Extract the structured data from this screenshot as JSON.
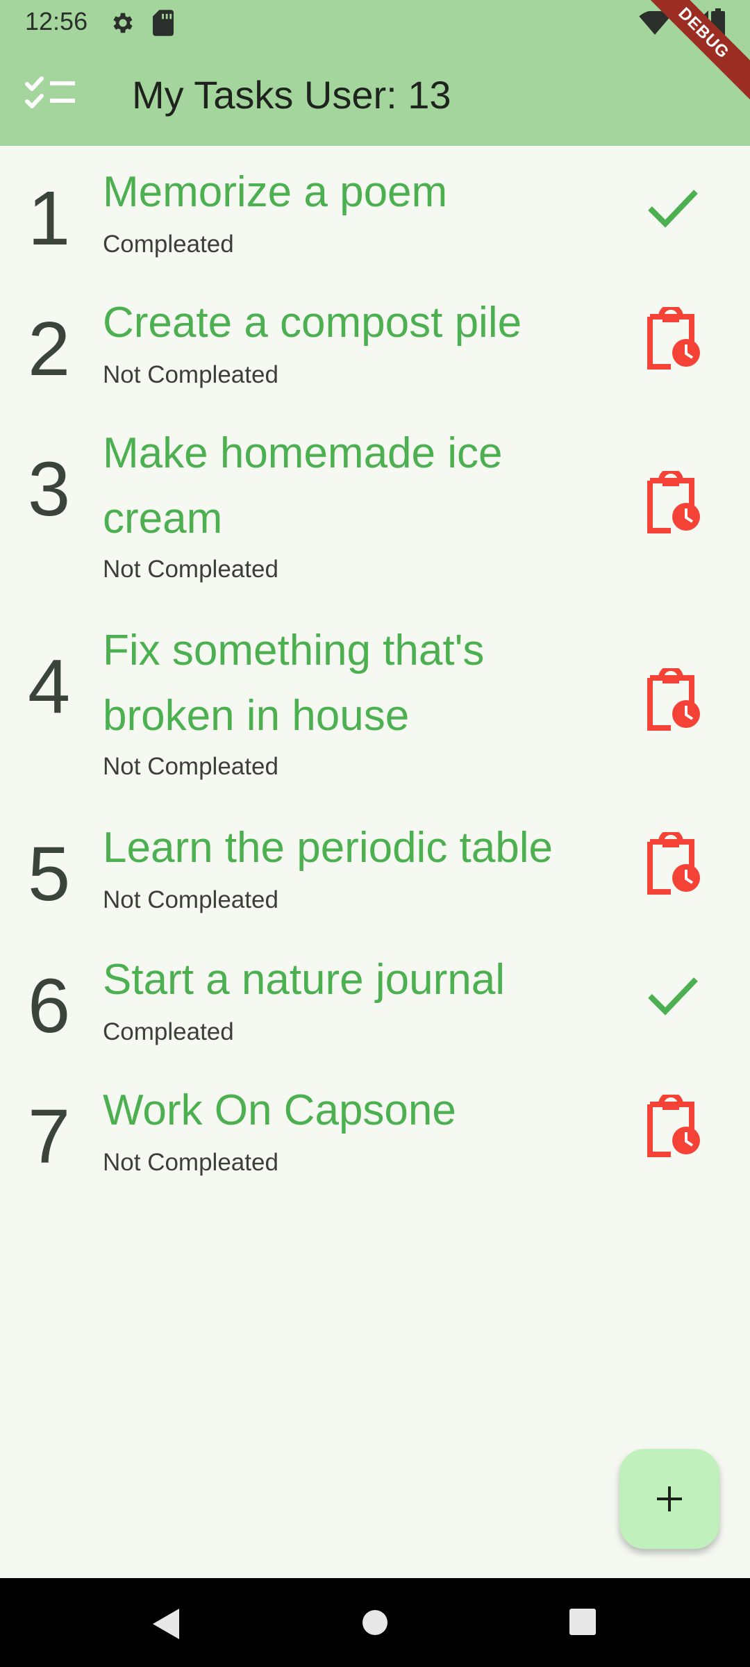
{
  "status_bar": {
    "time": "12:56"
  },
  "debug_banner": "DEBUG",
  "app_bar": {
    "title": "My Tasks User: 13",
    "icon": "checklist-icon"
  },
  "tasks": [
    {
      "number": "1",
      "title": "Memorize a poem",
      "status": "Compleated",
      "icon": "check-icon"
    },
    {
      "number": "2",
      "title": "Create a compost pile",
      "status": "Not Compleated",
      "icon": "pending-clipboard-icon"
    },
    {
      "number": "3",
      "title": "Make homemade ice cream",
      "status": "Not Compleated",
      "icon": "pending-clipboard-icon"
    },
    {
      "number": "4",
      "title": "Fix something that's broken in house",
      "status": "Not Compleated",
      "icon": "pending-clipboard-icon"
    },
    {
      "number": "5",
      "title": "Learn the periodic table",
      "status": "Not Compleated",
      "icon": "pending-clipboard-icon"
    },
    {
      "number": "6",
      "title": "Start a nature journal",
      "status": "Compleated",
      "icon": "check-icon"
    },
    {
      "number": "7",
      "title": "Work On Capsone",
      "status": "Not Compleated",
      "icon": "pending-clipboard-icon"
    }
  ],
  "fab": {
    "icon": "plus-icon"
  },
  "colors": {
    "app_bar": "#a3d59c",
    "title_green": "#4caf50",
    "pending_red": "#f44336",
    "fab": "#c0f0bb"
  }
}
